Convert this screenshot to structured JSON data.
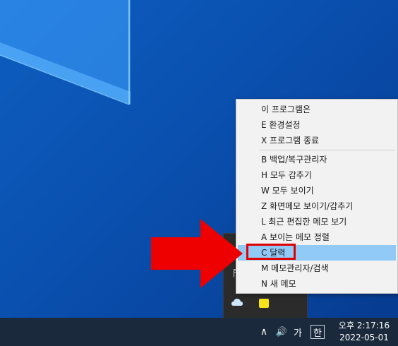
{
  "menu": {
    "items": [
      {
        "label": "이 프로그램은"
      },
      {
        "label": "E 환경설정"
      },
      {
        "label": "X 프로그램 종료"
      },
      {
        "label": "B 백업/복구관리자"
      },
      {
        "label": "H 모두 감추기"
      },
      {
        "label": "W 모두 보이기"
      },
      {
        "label": "Z 화면메모 보이기/감추기"
      },
      {
        "label": "L 최근 편집한 메모 보기"
      },
      {
        "label": "A 보이는 메모 정렬"
      },
      {
        "label": "C 달력"
      },
      {
        "label": "M 메모관리자/검색"
      },
      {
        "label": "N 새 메모"
      }
    ],
    "highlighted": "C 달력",
    "highlight_color": "#91c9f7"
  },
  "tray_overflow": {
    "icons": [
      "app-icon",
      "onedrive-cloud-icon",
      "sticky-memo-icon"
    ],
    "app_glyph": "門"
  },
  "taskbar": {
    "chevron_glyph": "∧",
    "volume_glyph": "🔊",
    "ime_label": "가",
    "han_label": "한",
    "clock": {
      "time": "오후 2:17:16",
      "date": "2022-05-01"
    }
  },
  "annotation": {
    "arrow_color": "#ee0000",
    "box_color": "#e00000"
  }
}
